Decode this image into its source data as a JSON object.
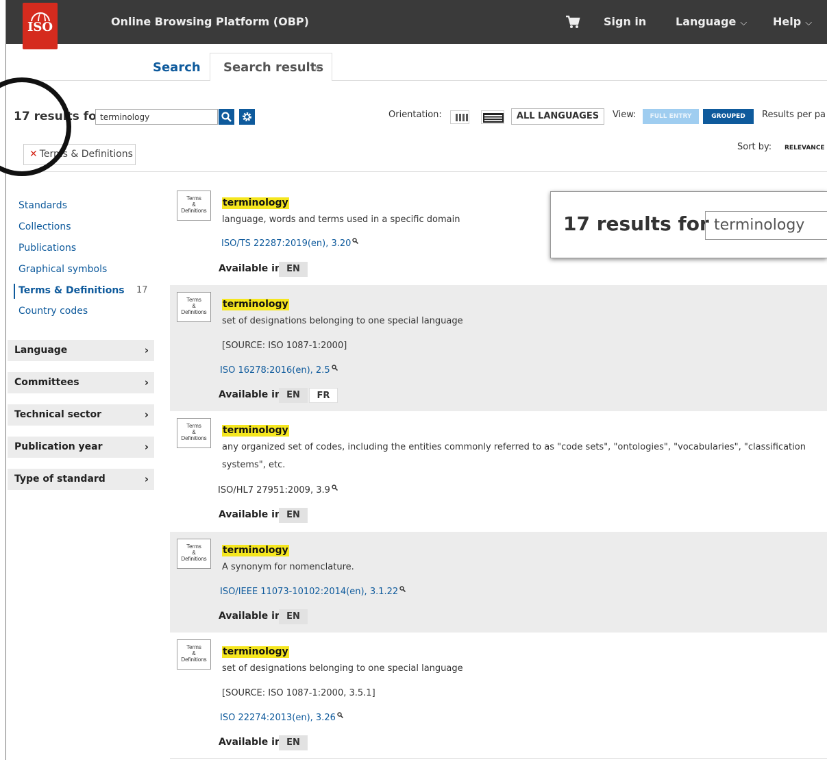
{
  "topbar": {
    "logo_text": "ISO",
    "app_title": "Online Browsing Platform (OBP)",
    "cart_icon": "cart-icon",
    "sign_in": "Sign in",
    "language": "Language",
    "help": "Help"
  },
  "tabs": {
    "search": "Search",
    "results": "Search results",
    "close": "×"
  },
  "search": {
    "results_label": "17 results for",
    "query": "terminology",
    "filter_chip": "Terms & Definitions",
    "filter_remove": "✕"
  },
  "toolbar": {
    "orientation_label": "Orientation:",
    "all_languages": "ALL LANGUAGES",
    "view_label": "View:",
    "view_full": "FULL ENTRY",
    "view_grouped": "GROUPED",
    "results_per_page": "Results per pa",
    "sort_label": "Sort by:",
    "sort_value": "RELEVANCE"
  },
  "sidebar": {
    "links": [
      "Standards",
      "Collections",
      "Publications",
      "Graphical symbols"
    ],
    "active": "Terms & Definitions",
    "active_count": "17",
    "country_codes": "Country codes",
    "facets": [
      "Language",
      "Committees",
      "Technical sector",
      "Publication year",
      "Type of standard"
    ],
    "facet_arrow": "›"
  },
  "results": [
    {
      "term": "terminology",
      "definition": "language, words and terms used in a specific domain",
      "source": "",
      "reference": "ISO/TS 22287:2019(en), 3.20",
      "languages": [
        "EN"
      ]
    },
    {
      "term": "terminology",
      "definition": "set of designations belonging to one special language",
      "source": "[SOURCE: ISO 1087-1:2000]",
      "reference": "ISO 16278:2016(en), 2.5",
      "languages": [
        "EN",
        "FR"
      ]
    },
    {
      "term": "terminology",
      "definition": "any organized set of codes, including the entities commonly referred to as \"code sets\", \"ontologies\", \"vocabularies\", \"classification systems\", etc.",
      "source": "",
      "reference": "ISO/HL7 27951:2009, 3.9",
      "languages": [
        "EN"
      ]
    },
    {
      "term": "terminology",
      "definition": "A synonym for nomenclature.",
      "source": "",
      "reference": "ISO/IEEE 11073-10102:2014(en), 3.1.22",
      "languages": [
        "EN"
      ]
    },
    {
      "term": "terminology",
      "definition": "set of designations belonging to one special language",
      "source": "[SOURCE: ISO 1087-1:2000, 3.5.1]",
      "reference": "ISO 22274:2013(en), 3.26",
      "languages": [
        "EN"
      ]
    }
  ],
  "available_label": "Available in:",
  "doc_icon": {
    "line1": "Terms",
    "line2": "&",
    "line3": "Definitions"
  },
  "callout": {
    "label": "17 results for",
    "query": "terminology"
  },
  "colors": {
    "brand_red": "#d52b1e",
    "link_blue": "#0e5a9c",
    "highlight": "#f5e61f",
    "topbar": "#3a3a3a"
  }
}
